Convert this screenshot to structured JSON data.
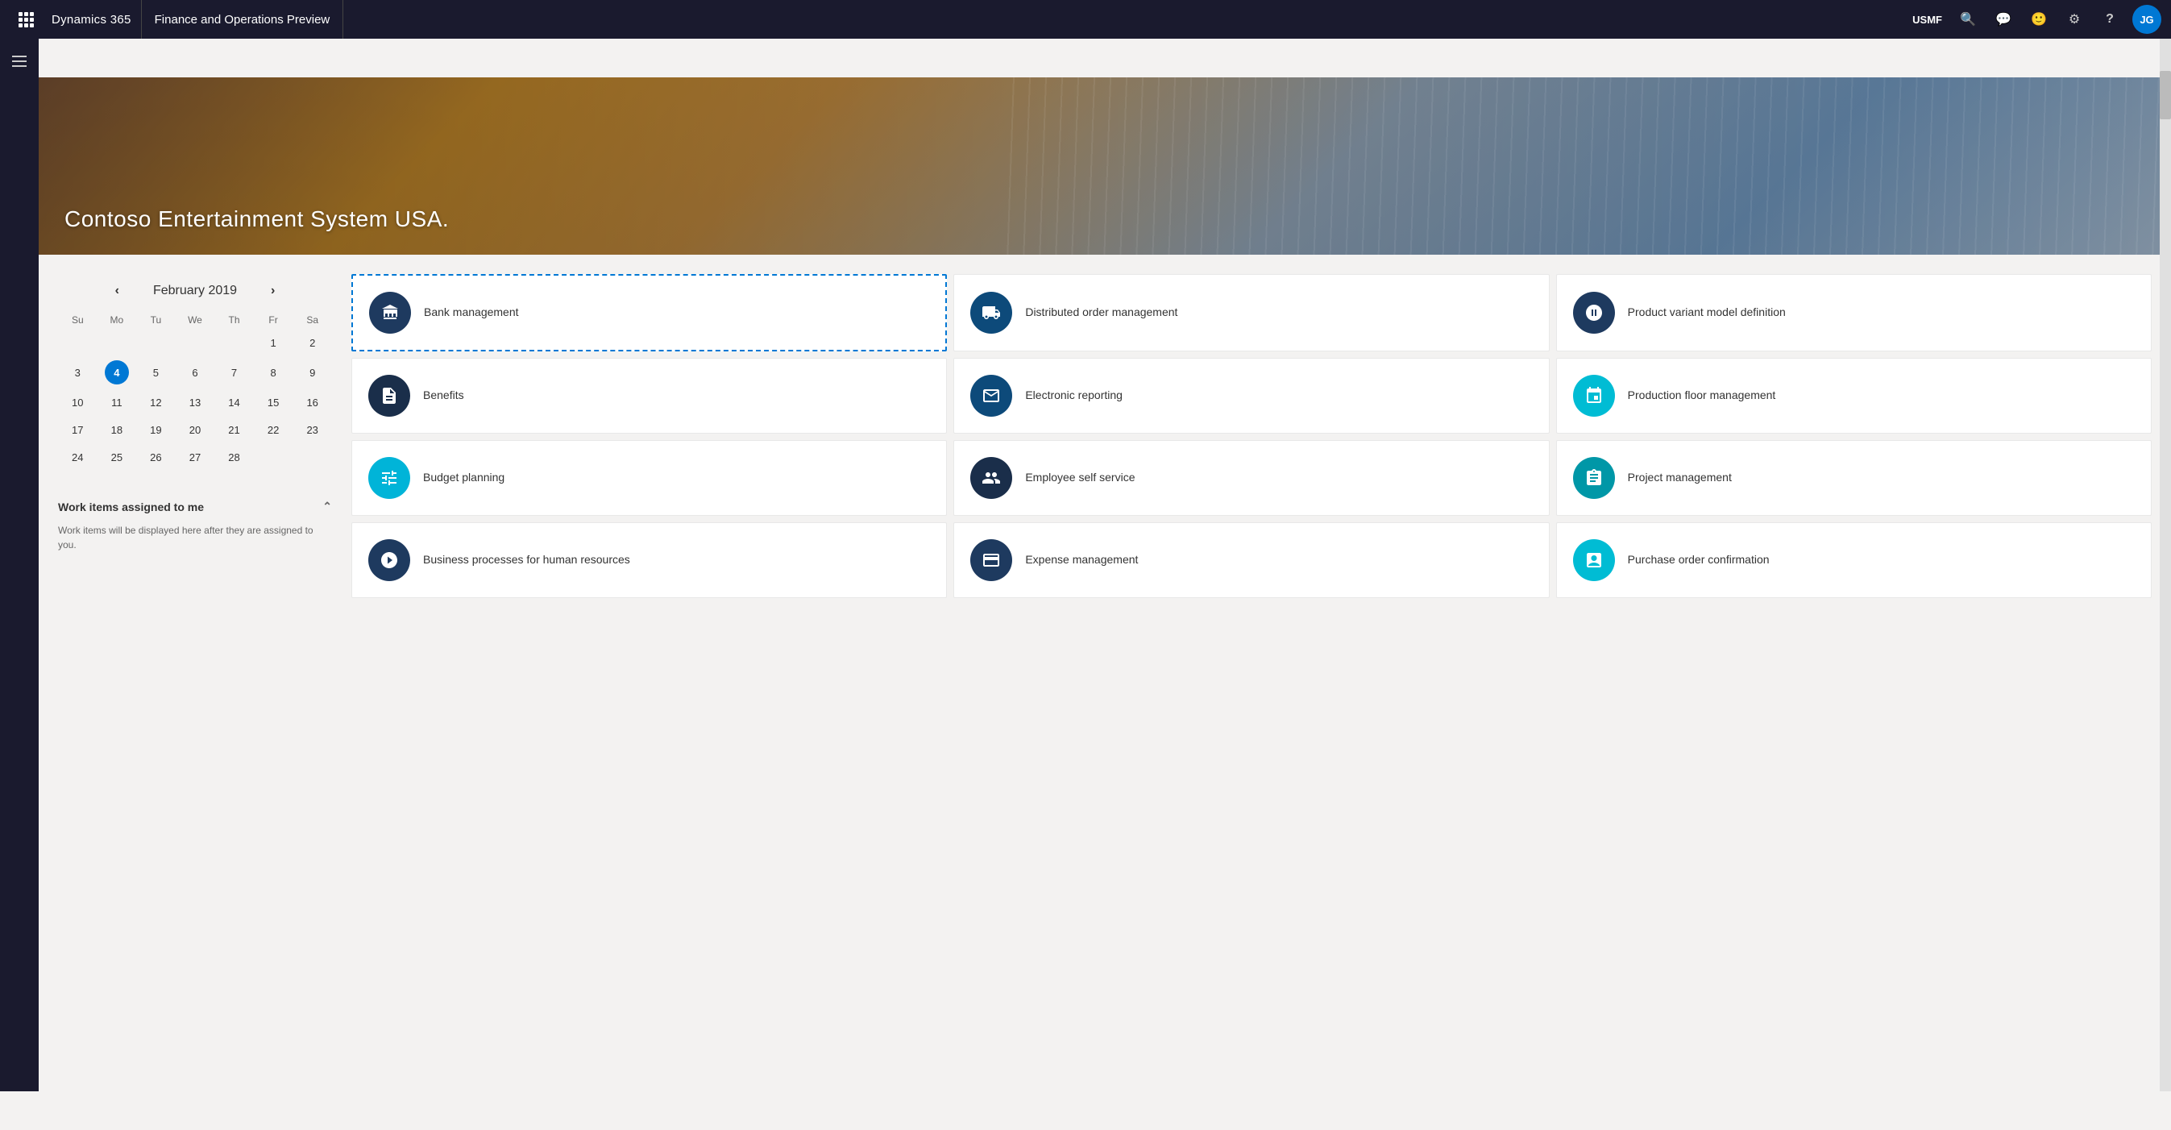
{
  "topnav": {
    "brand": "Dynamics 365",
    "app_name": "Finance and Operations Preview",
    "company": "USMF",
    "avatar_initials": "JG",
    "icons": {
      "search": "🔍",
      "chat": "💬",
      "emoji": "🙂",
      "settings": "⚙",
      "help": "?"
    }
  },
  "hero": {
    "title": "Contoso Entertainment System USA."
  },
  "calendar": {
    "month": "February",
    "year": "2019",
    "days_header": [
      "Su",
      "Mo",
      "Tu",
      "We",
      "Th",
      "Fr",
      "Sa"
    ],
    "weeks": [
      [
        "",
        "",
        "",
        "",
        "",
        "1",
        "2"
      ],
      [
        "3",
        "4",
        "5",
        "6",
        "7",
        "8",
        "9"
      ],
      [
        "10",
        "11",
        "12",
        "13",
        "14",
        "15",
        "16"
      ],
      [
        "17",
        "18",
        "19",
        "20",
        "21",
        "22",
        "23"
      ],
      [
        "24",
        "25",
        "26",
        "27",
        "28",
        "",
        ""
      ]
    ],
    "today": "4"
  },
  "work_items": {
    "heading": "Work items assigned to me",
    "body_text": "Work items will be displayed here after they are assigned to you."
  },
  "tiles": [
    {
      "id": "bank-management",
      "label": "Bank management",
      "icon_class": "ic-navy",
      "icon_char": "🏛",
      "selected": true
    },
    {
      "id": "distributed-order-management",
      "label": "Distributed order management",
      "icon_class": "ic-midblue",
      "icon_char": "📦",
      "selected": false
    },
    {
      "id": "product-variant-model-definition",
      "label": "Product variant model definition",
      "icon_class": "ic-navy",
      "icon_char": "🔧",
      "selected": false
    },
    {
      "id": "benefits",
      "label": "Benefits",
      "icon_class": "ic-darknavy",
      "icon_char": "📋",
      "selected": false
    },
    {
      "id": "electronic-reporting",
      "label": "Electronic reporting",
      "icon_class": "ic-midblue",
      "icon_char": "📊",
      "selected": false
    },
    {
      "id": "production-floor-management",
      "label": "Production floor management",
      "icon_class": "ic-cyan",
      "icon_char": "🏭",
      "selected": false
    },
    {
      "id": "budget-planning",
      "label": "Budget planning",
      "icon_class": "ic-teal",
      "icon_char": "📝",
      "selected": false
    },
    {
      "id": "employee-self-service",
      "label": "Employee self service",
      "icon_class": "ic-darknavy",
      "icon_char": "👤",
      "selected": false
    },
    {
      "id": "project-management",
      "label": "Project management",
      "icon_class": "ic-steelteal",
      "icon_char": "📐",
      "selected": false
    },
    {
      "id": "business-processes-human-resources",
      "label": "Business processes for human resources",
      "icon_class": "ic-navy",
      "icon_char": "⚙",
      "selected": false
    },
    {
      "id": "expense-management",
      "label": "Expense management",
      "icon_class": "ic-darkblue",
      "icon_char": "💳",
      "selected": false
    },
    {
      "id": "purchase-order-confirmation",
      "label": "Purchase order confirmation",
      "icon_class": "ic-cyan",
      "icon_char": "🧾",
      "selected": false
    }
  ]
}
